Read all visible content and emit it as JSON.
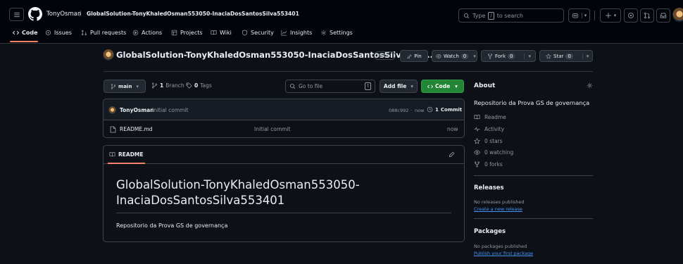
{
  "header": {
    "owner": "TonyOsman",
    "separator": "/",
    "repo": "GlobalSolution-TonyKhaledOsman553050-InaciaDosSantosSilva553401",
    "search_prefix": "Type",
    "search_key": "/",
    "search_suffix": "to search"
  },
  "tabs": [
    {
      "label": "Code",
      "icon": "code-icon"
    },
    {
      "label": "Issues",
      "icon": "issue-icon"
    },
    {
      "label": "Pull requests",
      "icon": "pull-request-icon"
    },
    {
      "label": "Actions",
      "icon": "play-icon"
    },
    {
      "label": "Projects",
      "icon": "table-icon"
    },
    {
      "label": "Wiki",
      "icon": "book-icon"
    },
    {
      "label": "Security",
      "icon": "shield-icon"
    },
    {
      "label": "Insights",
      "icon": "graph-icon"
    },
    {
      "label": "Settings",
      "icon": "gear-icon"
    }
  ],
  "repo": {
    "title": "GlobalSolution-TonyKhaledOsman553050-InaciaDosSantosSilva553...",
    "visibility": "Public",
    "pin": "Pin",
    "watch": "Watch",
    "watch_count": "0",
    "fork": "Fork",
    "fork_count": "0",
    "star": "Star",
    "star_count": "0"
  },
  "toolbar": {
    "branch": "main",
    "branches_count": "1",
    "branches_label": "Branch",
    "tags_count": "0",
    "tags_label": "Tags",
    "goto_placeholder": "Go to file",
    "goto_key": "t",
    "add_file": "Add file",
    "code": "Code"
  },
  "commit": {
    "author": "TonyOsman",
    "message": "Initial commit",
    "hash": "088c992",
    "sep": "·",
    "time": "now",
    "count": "1",
    "count_label": "Commit"
  },
  "files": [
    {
      "name": "README.md",
      "message": "Initial commit",
      "time": "now"
    }
  ],
  "readme": {
    "tab": "README",
    "heading_line1": "GlobalSolution-TonyKhaledOsman553050-",
    "heading_line2": "InaciaDosSantosSilva553401",
    "body": "Repositorio da Prova GS de governança"
  },
  "about": {
    "title": "About",
    "description": "Repositorio da Prova GS de governança",
    "items": [
      {
        "label": "Readme",
        "icon": "book-icon"
      },
      {
        "label": "Activity",
        "icon": "pulse-icon"
      },
      {
        "label": "0 stars",
        "icon": "star-icon"
      },
      {
        "label": "0 watching",
        "icon": "eye-icon"
      },
      {
        "label": "0 forks",
        "icon": "fork-icon"
      }
    ]
  },
  "releases": {
    "title": "Releases",
    "empty": "No releases published",
    "link": "Create a new release"
  },
  "packages": {
    "title": "Packages",
    "empty": "No packages published",
    "link": "Publish your first package"
  },
  "colors": {
    "bg": "#0d1117",
    "header": "#010409",
    "accent": "#f78166",
    "primary_btn": "#238636",
    "link": "#4493f8",
    "border": "#3d444d"
  }
}
